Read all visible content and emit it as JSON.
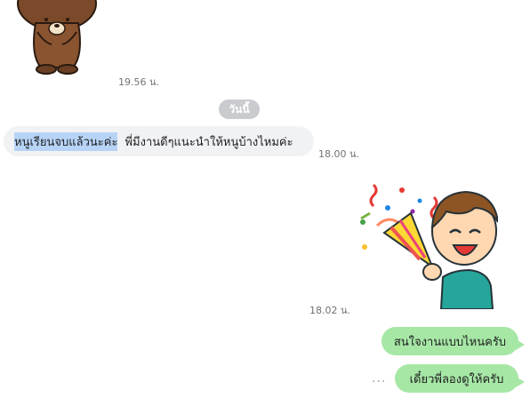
{
  "messages": [
    {
      "type": "sticker",
      "who": "other",
      "sticker": "brown-bear-sticker",
      "time": "19.56 น."
    },
    {
      "type": "date",
      "label": "วันนี้"
    },
    {
      "type": "text",
      "who": "other",
      "text_highlighted": "หนูเรียนจบแล้วนะค่ะ",
      "text": "พี่มีงานดีๆแนะนำให้หนูบ้างไหมค่ะ",
      "time": "18.00 น."
    },
    {
      "type": "sticker",
      "who": "me",
      "sticker": "boy-party-popper-sticker",
      "time": "18.02 น."
    },
    {
      "type": "text",
      "who": "me",
      "text": "สนใจงานแบบไหนครับ"
    },
    {
      "type": "text",
      "who": "me",
      "text": "เดี๋ยวพี่ลองดูให้ครับ",
      "status": "..."
    }
  ],
  "colors": {
    "incoming_bubble": "#f1f2f4",
    "outgoing_bubble": "#a6e7a6",
    "highlight": "#b7d4f7",
    "date_pill": "#c9cbcf"
  }
}
